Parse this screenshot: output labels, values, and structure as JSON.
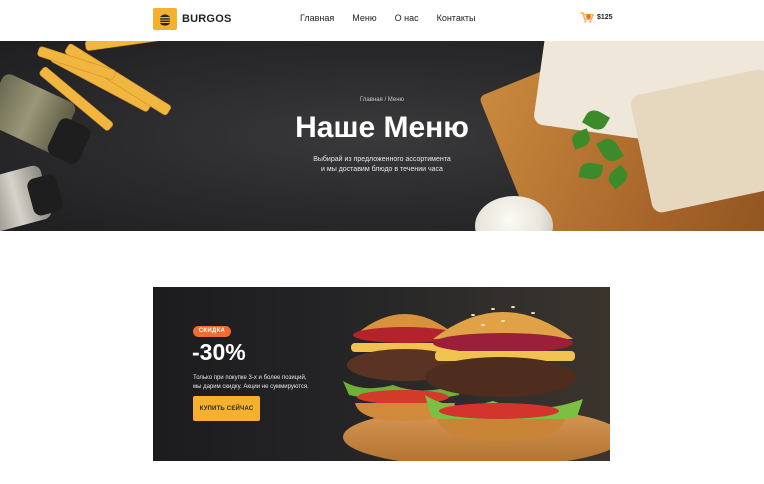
{
  "header": {
    "logo_text": "BURGOS",
    "nav": [
      "Главная",
      "Меню",
      "О нас",
      "Контакты"
    ],
    "cart_total": "$125"
  },
  "hero": {
    "breadcrumb": "Главная / Меню",
    "title": "Наше Меню",
    "subtitle_line1": "Выбирай из предложенного ассортимента",
    "subtitle_line2": "и мы доставим блюдо в течении часа"
  },
  "promo": {
    "badge": "СКИДКА",
    "discount": "-30%",
    "text_line1": "Только при покупке 3-х и более позиций,",
    "text_line2": "мы дарим скидку. Акции не суммируются.",
    "button_label": "КУПИТЬ СЕЙЧАС"
  },
  "colors": {
    "accent": "#f5b02e",
    "badge": "#f26b30",
    "hero_bg": "#2b2b2d"
  },
  "icons": [
    "burger-logo-icon",
    "cart-icon"
  ]
}
